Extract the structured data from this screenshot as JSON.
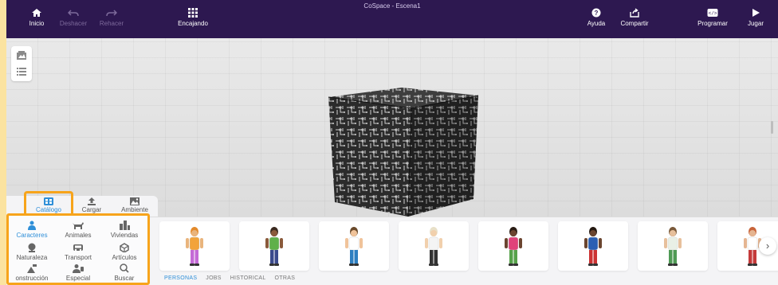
{
  "window_title": "CoSpace - Escena1",
  "toolbar": {
    "home": "Inicio",
    "undo": "Deshacer",
    "redo": "Rehacer",
    "snap": "Encajando",
    "help": "Ayuda",
    "share": "Compartir",
    "code": "Programar",
    "play": "Jugar"
  },
  "library_tabs": [
    {
      "label": "Catálogo",
      "active": true
    },
    {
      "label": "Cargar",
      "active": false
    },
    {
      "label": "Ambiente",
      "active": false
    }
  ],
  "categories": [
    {
      "label": "Caracteres",
      "icon": "person-icon",
      "active": true
    },
    {
      "label": "Animales",
      "icon": "animal-icon",
      "active": false
    },
    {
      "label": "Viviendas",
      "icon": "building-icon",
      "active": false
    },
    {
      "label": "Naturaleza",
      "icon": "nature-icon",
      "active": false
    },
    {
      "label": "Transport",
      "icon": "car-icon",
      "active": false
    },
    {
      "label": "Artículos",
      "icon": "items-icon",
      "active": false
    },
    {
      "label": "onstrucción",
      "icon": "construction-icon",
      "active": false
    },
    {
      "label": "Especial",
      "icon": "special-icon",
      "active": false
    },
    {
      "label": "Buscar",
      "icon": "search-icon",
      "active": false
    }
  ],
  "subtabs": [
    {
      "label": "PERSONAS",
      "active": true
    },
    {
      "label": "JOBS",
      "active": false
    },
    {
      "label": "HISTORICAL",
      "active": false
    },
    {
      "label": "OTRAS",
      "active": false
    }
  ],
  "characters": [
    {
      "skin": "#e9b47c",
      "hair": "#e38a2b",
      "shirt": "#f2a33a",
      "pants": "#c46ad6"
    },
    {
      "skin": "#8a5a3b",
      "hair": "#3b2a20",
      "shirt": "#5fb04a",
      "pants": "#3b4a8c"
    },
    {
      "skin": "#f0c39a",
      "hair": "#6a4a2b",
      "shirt": "#ffffff",
      "pants": "#2e7fc1"
    },
    {
      "skin": "#f1d0ad",
      "hair": "#e8e0c8",
      "shirt": "#f4f4f4",
      "pants": "#333333"
    },
    {
      "skin": "#6b4430",
      "hair": "#2a1c14",
      "shirt": "#e0427a",
      "pants": "#56a24a"
    },
    {
      "skin": "#6a452f",
      "hair": "#241810",
      "shirt": "#2a5fb3",
      "pants": "#cc3333"
    },
    {
      "skin": "#e7c09c",
      "hair": "#7a5a3a",
      "shirt": "#e9f0e6",
      "pants": "#4f9a55"
    },
    {
      "skin": "#e5b591",
      "hair": "#c8643a",
      "shirt": "#ffffff",
      "pants": "#c43a3a"
    }
  ],
  "colors": {
    "topbar": "#2d1850",
    "accent": "#2f8fd8",
    "highlight": "#f7a41b"
  }
}
